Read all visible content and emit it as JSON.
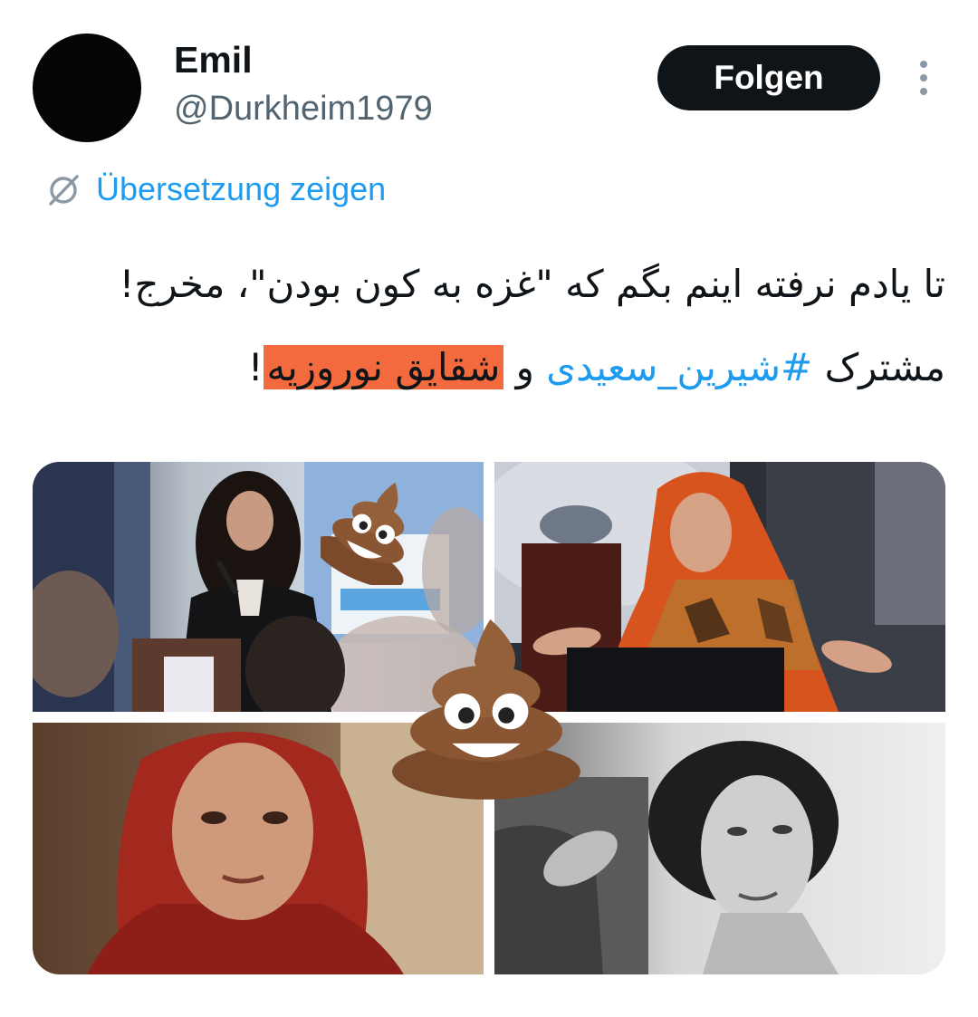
{
  "author": {
    "name": "Emil",
    "handle": "@Durkheim1979"
  },
  "actions": {
    "follow_label": "Folgen",
    "more_icon": "more-vertical-icon"
  },
  "translate": {
    "label": "Übersetzung zeigen",
    "icon": "globe-slash-icon"
  },
  "tweet": {
    "line1": "تا یادم نرفته اینم بگم که \"غزه به کون بودن\"، مخرج!",
    "line2_prefix": "مشترک ",
    "hashtag": "#شیرین_سعیدی",
    "connector": " و ",
    "highlighted": "شقایق نوروزیه",
    "suffix": "!",
    "highlight_color": "#f26a3e",
    "link_color": "#1d9bf0"
  },
  "media": {
    "images": [
      {
        "name": "woman-speaking-at-podium"
      },
      {
        "name": "woman-orange-headscarf-gesturing"
      },
      {
        "name": "woman-red-headscarf-portrait"
      },
      {
        "name": "woman-black-and-white-portrait"
      }
    ],
    "overlay_icon": "poop-emoji-icon"
  }
}
